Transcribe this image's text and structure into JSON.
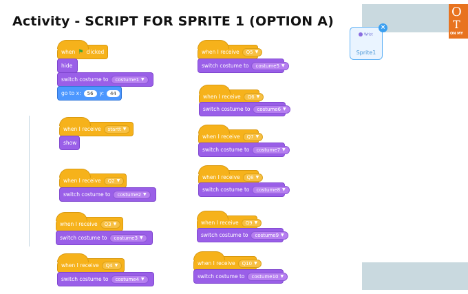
{
  "title": "Activity  - SCRIPT FOR SPRITE 1 (OPTION A)",
  "sprite": {
    "name": "Sprite1",
    "thumb_label": "Wrist",
    "close_glyph": "×"
  },
  "logo": {
    "letter1": "O",
    "letter2": "T",
    "tagline": "ON MY"
  },
  "blocks": {
    "green_flag_hat": "when",
    "green_flag_suffix": "clicked",
    "hide": "hide",
    "show": "show",
    "when_receive": "when I receive",
    "switch_costume": "switch costume to",
    "go_to_x": "go to x:",
    "go_to_y": "y:",
    "x_val": "56",
    "y_val": "44",
    "costume1": "costume1",
    "startt": "startt",
    "q2": "Q2",
    "costume2": "costume2",
    "q3": "Q3",
    "costume3": "costume3",
    "q4": "Q4",
    "costume4": "costume4",
    "q5": "Q5",
    "costume5": "costume5",
    "q6": "Q6",
    "costume6": "costume6",
    "q7": "Q7",
    "costume7": "costume7",
    "q8": "Q8",
    "costume8": "costume8",
    "q9": "Q9",
    "costume9": "costume9",
    "q10": "Q10",
    "costume10": "costume10"
  },
  "icons": {
    "flag": "green-flag-icon",
    "dropdown": "dropdown-arrow-icon"
  },
  "colors": {
    "events": "#f6b21b",
    "looks": "#9a5fe8",
    "motion": "#4c97ff"
  }
}
